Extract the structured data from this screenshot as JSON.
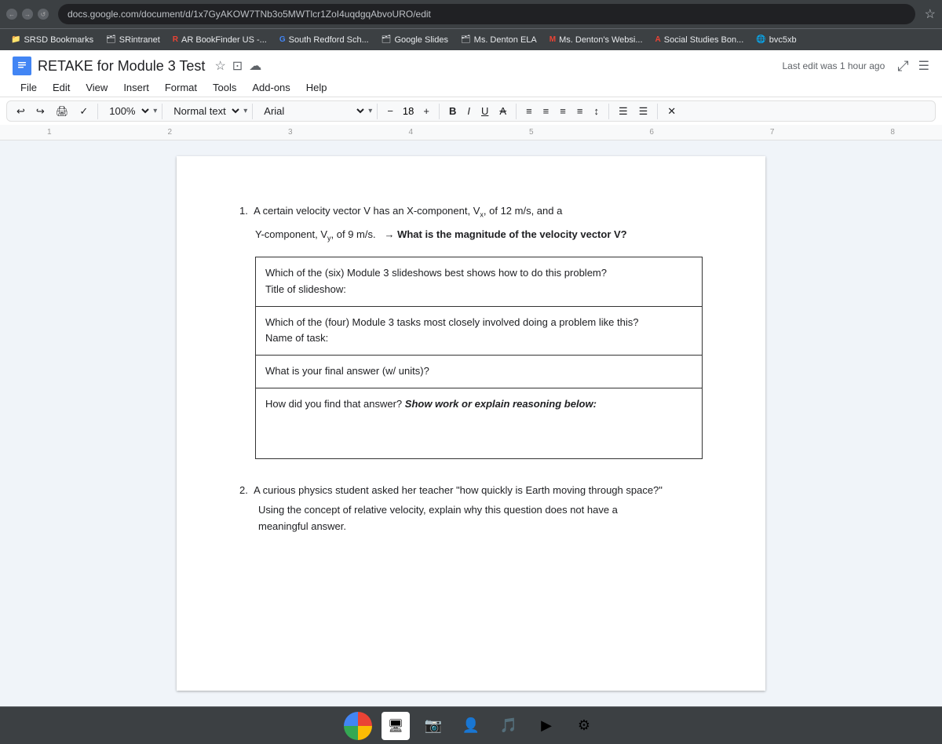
{
  "browser": {
    "address": "docs.google.com/document/d/1x7GyAKOW7TNb3o5MWTlcr1ZoI4uqdgqAbvoURO/edit",
    "star_icon": "★",
    "controls": [
      "←",
      "→",
      "↺"
    ]
  },
  "bookmarks": [
    {
      "id": "srsd",
      "label": "SRSD Bookmarks",
      "icon": "📁"
    },
    {
      "id": "srintranet",
      "label": "SRintranet",
      "icon": "🗂"
    },
    {
      "id": "ar-bookfinder",
      "label": "AR BookFinder US -...",
      "icon": "R"
    },
    {
      "id": "south-redford",
      "label": "South Redford Sch...",
      "icon": "G"
    },
    {
      "id": "google-slides",
      "label": "Google Slides",
      "icon": "🗂"
    },
    {
      "id": "ms-denton-ela",
      "label": "Ms. Denton ELA",
      "icon": "🗂"
    },
    {
      "id": "ms-denton-websi",
      "label": "Ms. Denton's Websi...",
      "icon": "M"
    },
    {
      "id": "social-studies",
      "label": "Social Studies Bon...",
      "icon": "A"
    },
    {
      "id": "bvc5x",
      "label": "bvc5xb",
      "icon": "🌐"
    }
  ],
  "docs": {
    "title": "RETAKE for Module 3 Test",
    "last_edit": "Last edit was 1 hour ago",
    "menu": {
      "items": [
        "File",
        "Edit",
        "View",
        "Insert",
        "Format",
        "Tools",
        "Add-ons",
        "Help"
      ]
    },
    "toolbar": {
      "zoom": "100%",
      "zoom_arrow": "▾",
      "style": "Normal text",
      "style_arrow": "▾",
      "font": "Arial",
      "font_arrow": "▾",
      "font_size": "18",
      "bold": "B",
      "italic": "I",
      "underline": "U",
      "strikethrough": "A",
      "align_left": "≡",
      "align_center": "≡",
      "align_right": "≡",
      "align_justify": "≡"
    },
    "content": {
      "question1": {
        "number": "1.",
        "text": "A certain velocity vector V has an X-component, V",
        "x_sub": "x",
        "text2": ", of 12 m/s, and a",
        "line2_pre": "Y-component, V",
        "y_sub": "y",
        "line2_post": ", of 9 m/s.",
        "arrow": "→",
        "bold_question": "What is the magnitude of the velocity vector V?",
        "table_rows": [
          {
            "label": "Which of the (six) Module 3 slideshows best shows how to do this problem?\nTitle of slideshow:"
          },
          {
            "label": "Which of the (four) Module 3 tasks most closely involved doing a problem like this?\nName of task:"
          },
          {
            "label": "What is your final answer (w/ units)?"
          },
          {
            "label": "How did you find that answer? Show work or explain reasoning below:",
            "blank": true
          }
        ]
      },
      "question2": {
        "number": "2.",
        "text": "A curious physics student asked her teacher \"how quickly is Earth moving through space?\"",
        "line2": "Using the concept of relative velocity, explain why this question does not have a",
        "line3": "meaningful answer."
      }
    }
  },
  "taskbar": {
    "items": [
      {
        "id": "chrome",
        "icon": "⊙",
        "color": "#4285f4"
      },
      {
        "id": "files",
        "icon": "🖥"
      },
      {
        "id": "camera",
        "icon": "📷"
      },
      {
        "id": "user",
        "icon": "👤"
      },
      {
        "id": "music",
        "icon": "🎵"
      },
      {
        "id": "play",
        "icon": "▶"
      },
      {
        "id": "settings",
        "icon": "⚙"
      }
    ]
  }
}
